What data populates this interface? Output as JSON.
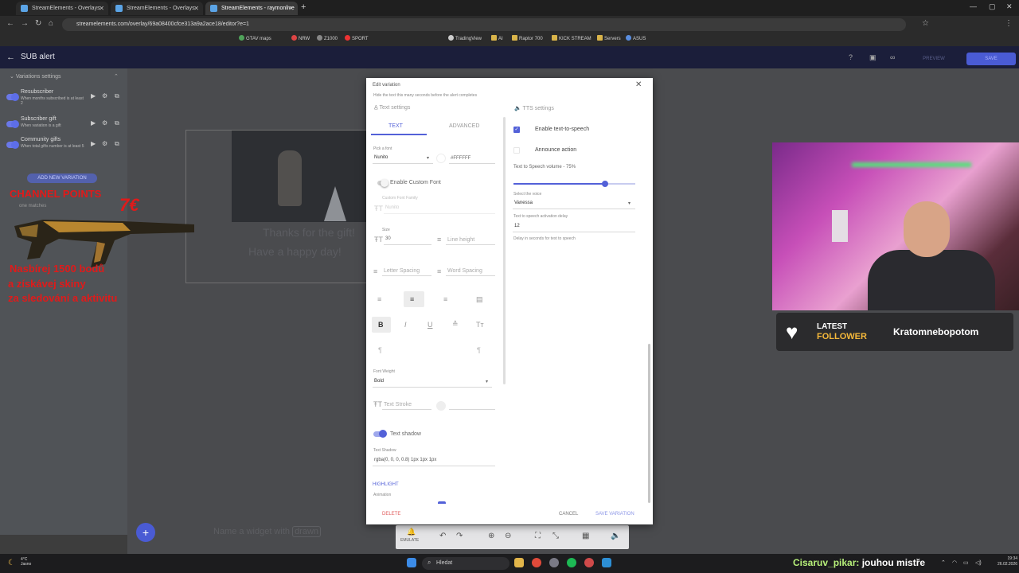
{
  "browser": {
    "tabs": [
      {
        "title": "StreamElements - Overlays"
      },
      {
        "title": "StreamElements - Overlays"
      },
      {
        "title": "StreamElements - raymonlive"
      }
    ],
    "url": "streamelements.com/overlay/69a08400cfce313a9a2ace18/editor?e=1",
    "bookmarks": [
      "GTAV maps",
      "NRW",
      "Z1000",
      "SPORT",
      "TradingView",
      "AI",
      "Raptor 700",
      "KICK STREAM",
      "Servers",
      "ASUS"
    ]
  },
  "header": {
    "title": "SUB alert",
    "preview_label": "PREVIEW",
    "save_label": "SAVE"
  },
  "sidebar": {
    "section_title": "Variations settings",
    "variations": [
      {
        "name": "Resubscriber",
        "desc": "When months subscribed is at least 2"
      },
      {
        "name": "Subscriber gift",
        "desc": "When variation is a gift"
      },
      {
        "name": "Community gifts",
        "desc": "When total gifts number is at least 5"
      }
    ],
    "add_variation_label": "ADD NEW VARIATION"
  },
  "promo": {
    "channel_points": "CHANNEL POINTS",
    "price": "7€",
    "line1": "Nasbírej 1500 bodů",
    "line2": "a získávej skiny",
    "line3": "za sledování a aktivitu",
    "gun_caption": "one matches"
  },
  "dialog": {
    "title": "Edit variation",
    "hint": "Hide the text this many seconds before the alert completes",
    "text_settings_label": "Text settings",
    "tts_settings_label": "TTS settings",
    "tabs": [
      "TEXT",
      "ADVANCED"
    ],
    "pick_font_label": "Pick a font",
    "font_value": "Nunito",
    "color_value": "#FFFFFF",
    "custom_font_toggle": "Enable Custom Font",
    "custom_font_family_label": "Custom Font Family",
    "custom_font_family_value": "Nunito",
    "size_label": "Size",
    "size_value": "30",
    "line_height_label": "Line height",
    "letter_spacing_label": "Letter Spacing",
    "word_spacing_label": "Word Spacing",
    "font_weight_label": "Font Weight",
    "font_weight_value": "Bold",
    "text_stroke_label": "Text Stroke",
    "text_shadow_toggle": "Text shadow",
    "text_shadow_label": "Text Shadow",
    "text_shadow_value": "rgba(0, 0, 0, 0.8) 1px 1px 1px",
    "highlight_label": "HIGHLIGHT",
    "animation_label": "Animation",
    "tts_enable": "Enable text-to-speech",
    "announce_action": "Announce action",
    "tts_volume_label": "Text to Speech volume - 75%",
    "tts_volume_value": 0.75,
    "voice_label": "Select the voice",
    "voice_value": "Vanessa",
    "delay_label": "Text to speech activation delay",
    "delay_value": "12",
    "delay_hint": "Delay in seconds for text to speech",
    "delete_label": "DELETE",
    "cancel_label": "CANCEL",
    "save_variation_label": "SAVE VARIATION"
  },
  "stage": {
    "bg_text1": "Thanks for the gift!",
    "bg_text2": "Have a happy day!",
    "name_widget_text": "Name a widget with",
    "name_widget_hint": "drawn"
  },
  "toolbar": {
    "emulate_label": "EMULATE"
  },
  "follower": {
    "latest": "LATEST",
    "follower": "FOLLOWER",
    "name": "Kratomnebopotom"
  },
  "taskbar": {
    "weather_temp": "4°C",
    "weather_desc": "Jasno",
    "search_placeholder": "Hledat",
    "chat_user": "Cisaruv_pikar:",
    "chat_msg": "jouhou mistře",
    "time": "19:34",
    "date": "26.02.2026"
  },
  "colors": {
    "accent": "#5361d8",
    "header_bg": "#1b1e3a",
    "promo_red": "#e01a1a",
    "follower_gold": "#f5b83a",
    "delete_red": "#e05a5a"
  }
}
